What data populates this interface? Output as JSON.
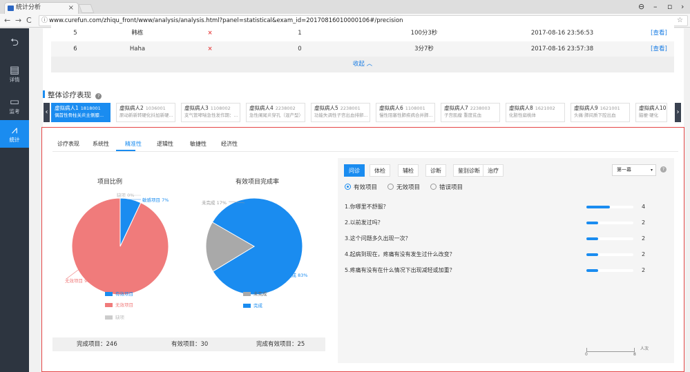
{
  "browser": {
    "tab_title": "统计分析",
    "tab_close": "×",
    "url": "www.curefun.com/zhiqu_front/www/analysis/analysis.html?panel=statistical&exam_id=20170816010000106#/precision"
  },
  "sidebar": {
    "items": [
      {
        "icon": "back-icon",
        "glyph": "⮌",
        "label": ""
      },
      {
        "icon": "detail-icon",
        "glyph": "▤",
        "label": "详情"
      },
      {
        "icon": "monitor-icon",
        "glyph": "▭",
        "label": "监考"
      },
      {
        "icon": "chart-icon",
        "glyph": "⩘",
        "label": "统计"
      }
    ]
  },
  "table": {
    "rows": [
      {
        "no": "5",
        "name": "韩栋",
        "mark": "×",
        "score": "1",
        "duration": "100分3秒",
        "time": "2017-08-16 23:56:53",
        "action": "[查看]"
      },
      {
        "no": "6",
        "name": "Haha",
        "mark": "×",
        "score": "0",
        "duration": "3分7秒",
        "time": "2017-08-16 23:57:38",
        "action": "[查看]"
      }
    ],
    "collapse_label": "收起 ︿"
  },
  "section": {
    "title": "整体诊疗表现",
    "help": "?"
  },
  "patients": [
    {
      "name": "虚拟病人1",
      "code": "1818001",
      "desc": "偶首性骨柱关炎主侧膝..."
    },
    {
      "name": "虚拟病人2",
      "code": "1036001",
      "desc": "原动新新转硬化抖加新硬..."
    },
    {
      "name": "虚拟病人3",
      "code": "1108002",
      "desc": "支气管哮喘急性发作期：..."
    },
    {
      "name": "虚拟病人4",
      "code": "2238002",
      "desc": "急性阑尾炎穿孔（混产型）"
    },
    {
      "name": "虚拟病人5",
      "code": "2238001",
      "desc": "功能失调性子宫出血排卵..."
    },
    {
      "name": "虚拟病人6",
      "code": "1108001",
      "desc": "慢性阻塞性肺疾病合并肺..."
    },
    {
      "name": "虚拟病人7",
      "code": "2238003",
      "desc": "子宫肌瘤 重度贫血"
    },
    {
      "name": "虚拟病人8",
      "code": "1621002",
      "desc": "化脓性扁桃体"
    },
    {
      "name": "虚拟病人9",
      "code": "1621001",
      "desc": "头痛·肺间质下腔出血"
    },
    {
      "name": "虚拟病人10",
      "code": "",
      "desc": "脑梗·硬化"
    }
  ],
  "patient_nav": {
    "prev": "‹",
    "next": "›"
  },
  "sub_tabs": [
    "诊疗表现",
    "系统性",
    "精准性",
    "逻辑性",
    "敏捷性",
    "经济性"
  ],
  "sub_tab_active": 2,
  "pie1": {
    "title": "项目比例",
    "labels": {
      "missing": "缺项 0%",
      "effective": "敏感项目 7%",
      "invalid": "无效项目 93%"
    },
    "legend": [
      "有效项目",
      "无效项目",
      "缺项"
    ]
  },
  "pie2": {
    "title": "有效项目完成率",
    "labels": {
      "incomplete": "未完成 17%",
      "complete": "完成 83%"
    },
    "legend": [
      "未完成",
      "完成"
    ]
  },
  "summary": {
    "completed": "完成项目：246",
    "effective": "有效项目：30",
    "completed_effective": "完成有效项目：25"
  },
  "right": {
    "tabs": [
      "问诊",
      "体检",
      "辅检",
      "诊断",
      "鉴别诊断",
      "治疗"
    ],
    "tab_active": 0,
    "select_value": "第一幕",
    "select_caret": "▾",
    "help": "?",
    "radios": [
      "有效项目",
      "无效项目",
      "错误项目"
    ],
    "radio_selected": 0,
    "questions": [
      {
        "q": "1.你哪里不舒服？",
        "count": "4"
      },
      {
        "q": "2.以前发过吗？",
        "count": "2"
      },
      {
        "q": "3.这个问题多久出现一次？",
        "count": "2"
      },
      {
        "q": "4.起病到现在，疼痛有没有发生过什么改变？",
        "count": "2"
      },
      {
        "q": "5.疼痛有没有在什么情况下出现减轻或加重？",
        "count": "2"
      }
    ],
    "axis": {
      "min": "0",
      "max": "8",
      "unit": "人次"
    }
  },
  "chart_data": [
    {
      "type": "pie",
      "title": "项目比例",
      "slices": [
        {
          "name": "有效项目",
          "value": 7,
          "color": "#1a8cf0"
        },
        {
          "name": "无效项目",
          "value": 93,
          "color": "#f07b7b"
        },
        {
          "name": "缺项",
          "value": 0,
          "color": "#cccccc"
        }
      ]
    },
    {
      "type": "pie",
      "title": "有效项目完成率",
      "slices": [
        {
          "name": "完成",
          "value": 83,
          "color": "#1a8cf0"
        },
        {
          "name": "未完成",
          "value": 17,
          "color": "#a9a9a9"
        }
      ]
    },
    {
      "type": "bar",
      "categories": [
        "1.你哪里不舒服？",
        "2.以前发过吗？",
        "3.这个问题多久出现一次？",
        "4.起病到现在，疼痛有没有发生过什么改变？",
        "5.疼痛有没有在什么情况下出现减轻或加重？"
      ],
      "values": [
        4,
        2,
        2,
        2,
        2
      ],
      "xlim": [
        0,
        8
      ],
      "xlabel": "人次"
    }
  ],
  "colors": {
    "accent": "#1a8cf0",
    "danger": "#e54545",
    "sidebar": "#2d3540"
  }
}
